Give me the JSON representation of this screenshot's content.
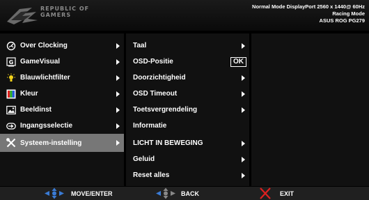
{
  "brand": {
    "logo_lines": [
      "REPUBLIC OF",
      "GAMERS"
    ]
  },
  "status": {
    "line1": "Normal Mode DisplayPort 2560 x 1440@ 60Hz",
    "line2": "Racing Mode",
    "line3": "ASUS ROG PG279"
  },
  "main_menu": {
    "items": [
      {
        "label": "Over Clocking",
        "icon": "overclock-icon"
      },
      {
        "label": "GameVisual",
        "icon": "gamevisual-icon"
      },
      {
        "label": "Blauwlichtfilter",
        "icon": "bluelight-icon"
      },
      {
        "label": "Kleur",
        "icon": "color-icon"
      },
      {
        "label": "Beeldinst",
        "icon": "image-icon"
      },
      {
        "label": "Ingangsselectie",
        "icon": "input-icon"
      },
      {
        "label": "Systeem-instelling",
        "icon": "tools-icon",
        "selected": true
      }
    ]
  },
  "sub_menu": {
    "items": [
      {
        "label": "Taal"
      },
      {
        "label": "OSD-Positie",
        "badge": "OK"
      },
      {
        "label": "Doorzichtigheid"
      },
      {
        "label": "OSD Timeout"
      },
      {
        "label": "Toetsvergrendeling"
      },
      {
        "label": "Informatie"
      },
      {
        "label": "LICHT IN BEWEGING"
      },
      {
        "label": "Geluid"
      },
      {
        "label": "Reset alles"
      }
    ]
  },
  "footer": {
    "move_label": "MOVE/ENTER",
    "back_label": "BACK",
    "exit_label": "EXIT"
  },
  "colors": {
    "accent_blue": "#3a7bd5",
    "selected_bg": "#777777",
    "exit_red": "#e02020"
  }
}
